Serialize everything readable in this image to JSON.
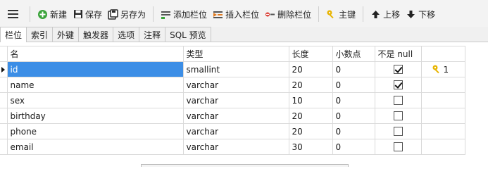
{
  "toolbar": {
    "new_label": "新建",
    "save_label": "保存",
    "save_as_label": "另存为",
    "add_field_label": "添加栏位",
    "insert_field_label": "插入栏位",
    "delete_field_label": "删除栏位",
    "primary_key_label": "主键",
    "move_up_label": "上移",
    "move_down_label": "下移"
  },
  "tabs": [
    "栏位",
    "索引",
    "外键",
    "触发器",
    "选项",
    "注释",
    "SQL 预览"
  ],
  "table": {
    "headers": {
      "name": "名",
      "type": "类型",
      "length": "长度",
      "decimals": "小数点",
      "not_null": "不是 null",
      "key": ""
    },
    "rows": [
      {
        "name": "id",
        "type": "smallint",
        "length": "20",
        "decimals": "0",
        "not_null": true,
        "key": "1"
      },
      {
        "name": "name",
        "type": "varchar",
        "length": "20",
        "decimals": "0",
        "not_null": true,
        "key": ""
      },
      {
        "name": "sex",
        "type": "varchar",
        "length": "10",
        "decimals": "0",
        "not_null": false,
        "key": ""
      },
      {
        "name": "birthday",
        "type": "varchar",
        "length": "20",
        "decimals": "0",
        "not_null": false,
        "key": ""
      },
      {
        "name": "phone",
        "type": "varchar",
        "length": "20",
        "decimals": "0",
        "not_null": false,
        "key": ""
      },
      {
        "name": "email",
        "type": "varchar",
        "length": "30",
        "decimals": "0",
        "not_null": false,
        "key": ""
      }
    ]
  },
  "colors": {
    "selection": "#3c8ee6",
    "key_icon": "#e8b400"
  }
}
